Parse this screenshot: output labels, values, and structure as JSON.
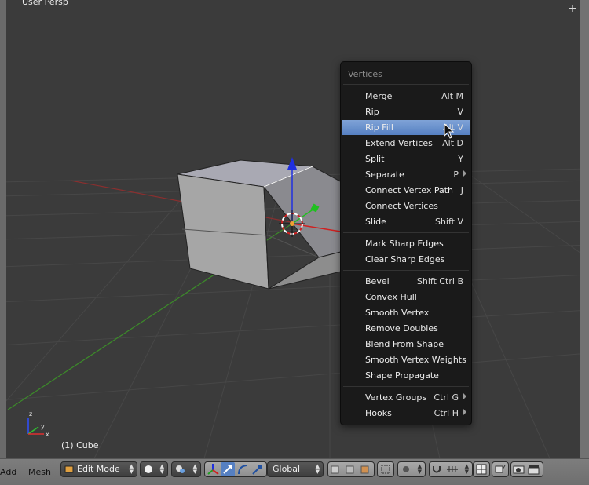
{
  "viewport": {
    "view_name": "User Persp",
    "object_name": "(1) Cube",
    "axis_widget": {
      "z": "z",
      "y": "y",
      "x": "x"
    }
  },
  "menu": {
    "title": "Vertices",
    "items": [
      {
        "label": "Merge",
        "shortcut": "Alt M"
      },
      {
        "label": "Rip",
        "shortcut": "V"
      },
      {
        "label": "Rip Fill",
        "shortcut": "Alt V",
        "highlighted": true
      },
      {
        "label": "Extend Vertices",
        "shortcut": "Alt D"
      },
      {
        "label": "Split",
        "shortcut": "Y"
      },
      {
        "label": "Separate",
        "shortcut": "P",
        "submenu": true
      },
      {
        "label": "Connect Vertex Path",
        "shortcut": "J"
      },
      {
        "label": "Connect Vertices",
        "shortcut": ""
      },
      {
        "label": "Slide",
        "shortcut": "Shift V"
      },
      {
        "label": "Mark Sharp Edges",
        "shortcut": ""
      },
      {
        "label": "Clear Sharp Edges",
        "shortcut": ""
      },
      {
        "label": "Bevel",
        "shortcut": "Shift Ctrl B"
      },
      {
        "label": "Convex Hull",
        "shortcut": ""
      },
      {
        "label": "Smooth Vertex",
        "shortcut": ""
      },
      {
        "label": "Remove Doubles",
        "shortcut": ""
      },
      {
        "label": "Blend From Shape",
        "shortcut": ""
      },
      {
        "label": "Smooth Vertex Weights",
        "shortcut": ""
      },
      {
        "label": "Shape Propagate",
        "shortcut": ""
      },
      {
        "label": "Vertex Groups",
        "shortcut": "Ctrl G",
        "submenu": true
      },
      {
        "label": "Hooks",
        "shortcut": "Ctrl H",
        "submenu": true
      }
    ]
  },
  "header": {
    "add_label": "Add",
    "mesh_label": "Mesh",
    "mode": "Edit Mode",
    "orientation": "Global"
  },
  "colors": {
    "highlight": "#5680c2",
    "menu_bg": "#1a1a1a",
    "viewport_bg": "#3b3b3b",
    "header_bg": "#727272"
  }
}
